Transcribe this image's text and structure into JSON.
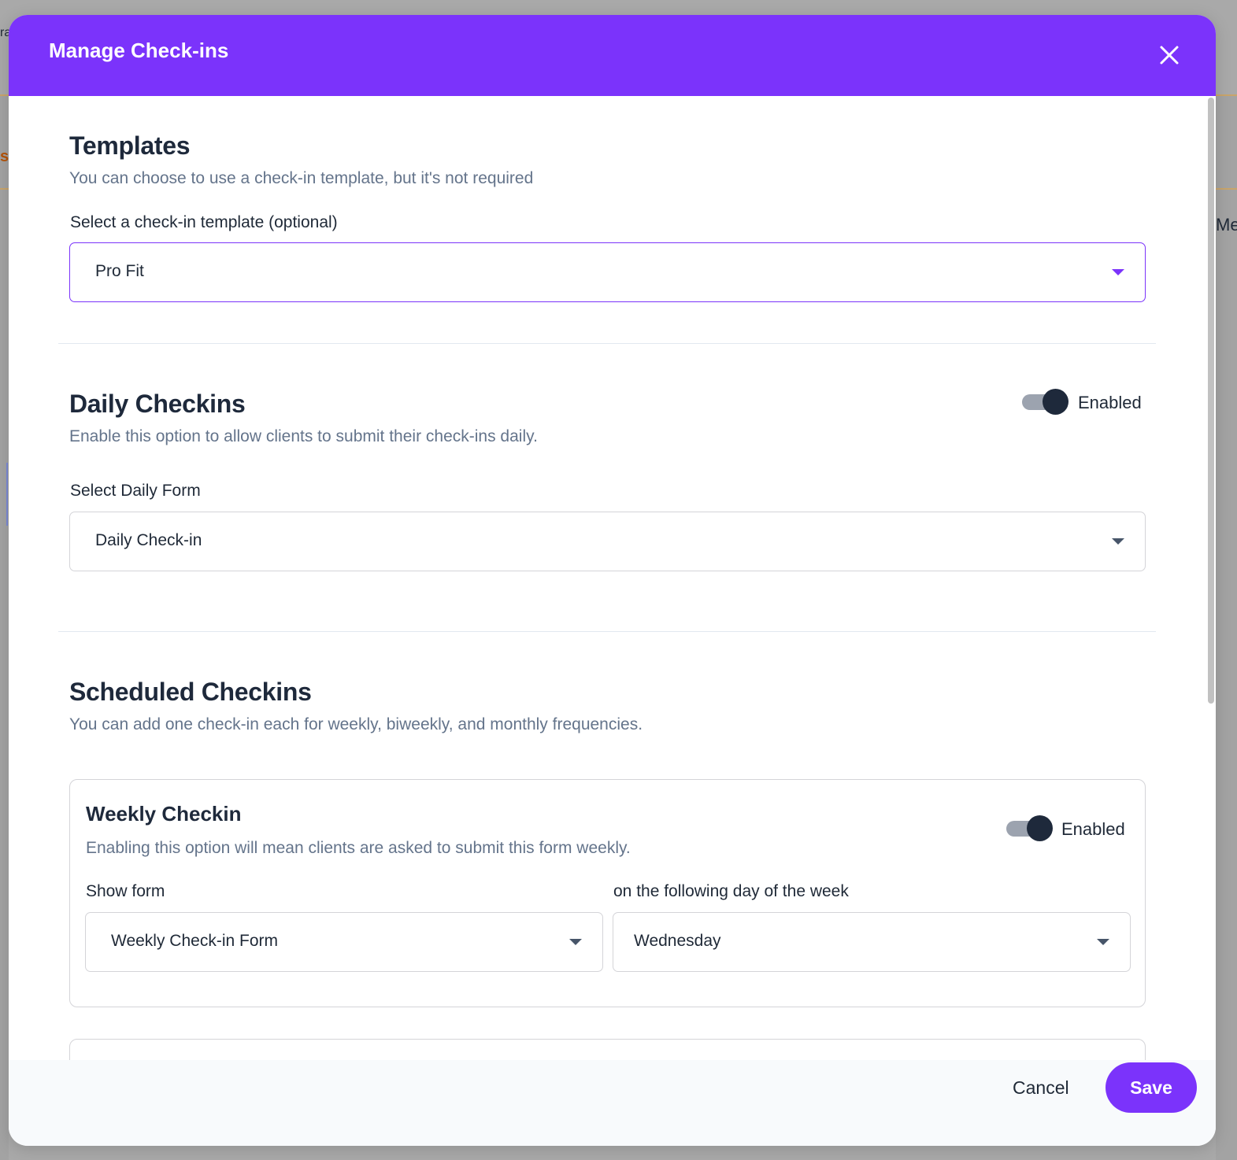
{
  "background": {
    "fragment_top_left": "ra",
    "fragment_left": "s",
    "fragment_right": "Me"
  },
  "modal": {
    "title": "Manage Check-ins",
    "close_icon": "close-icon"
  },
  "templates": {
    "title": "Templates",
    "description": "You can choose to use a check-in template, but it's not required",
    "select_label": "Select a check-in template (optional)",
    "selected_value": "Pro Fit"
  },
  "daily": {
    "title": "Daily Checkins",
    "description": "Enable this option to allow clients to submit their check-ins daily.",
    "toggle_label": "Enabled",
    "toggle_on": true,
    "select_label": "Select Daily Form",
    "selected_value": "Daily Check-in"
  },
  "scheduled": {
    "title": "Scheduled Checkins",
    "description": "You can add one check-in each for weekly, biweekly, and monthly frequencies.",
    "weekly": {
      "title": "Weekly Checkin",
      "description": "Enabling this option will mean clients are asked to submit this form weekly.",
      "toggle_label": "Enabled",
      "toggle_on": true,
      "form_label": "Show form",
      "form_value": "Weekly Check-in Form",
      "day_label": "on the following day of the week",
      "day_value": "Wednesday"
    }
  },
  "footer": {
    "cancel_label": "Cancel",
    "save_label": "Save"
  },
  "colors": {
    "accent": "#7b33fb",
    "toggle_knob": "#1e293b",
    "muted_text": "#64748b"
  }
}
